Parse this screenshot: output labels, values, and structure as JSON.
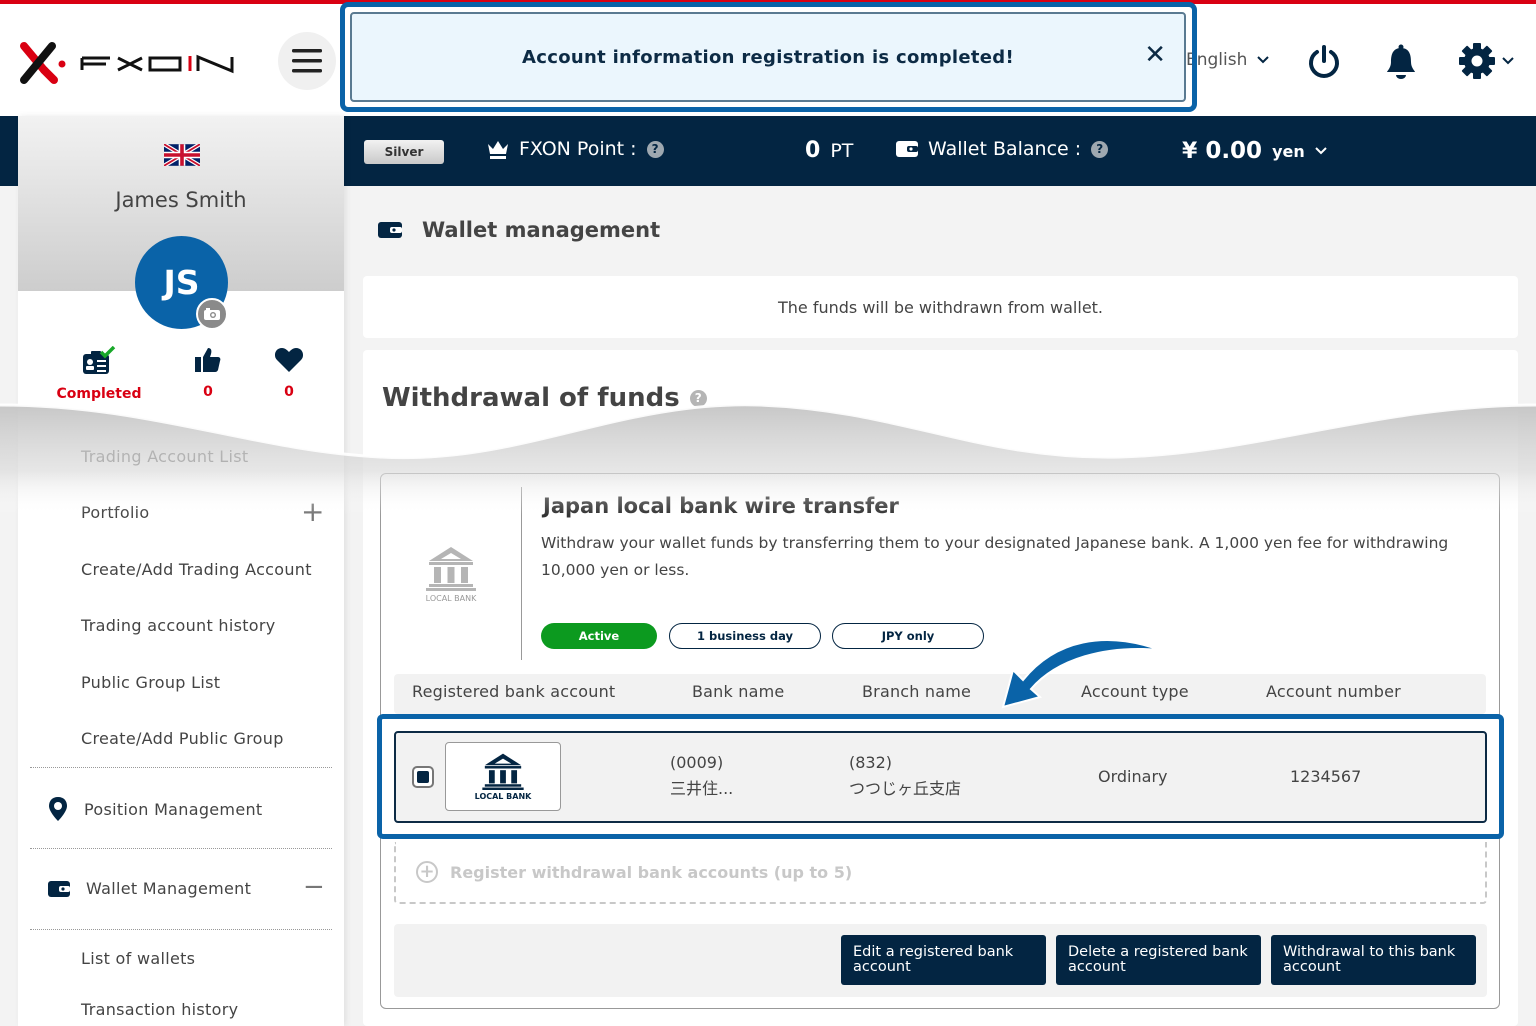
{
  "brand": {
    "name": "FXON",
    "accent_red": "#d90012",
    "navy": "#032542",
    "blue": "#0a63a8"
  },
  "header": {
    "language": "English",
    "icons": [
      "menu-icon",
      "power-icon",
      "bell-icon",
      "gear-icon"
    ]
  },
  "toast": {
    "message": "Account information registration is completed!",
    "close": "✕"
  },
  "status_bar": {
    "tier": "Silver",
    "point_label": "FXON Point :",
    "point_value": "0",
    "point_unit": "PT",
    "wallet_label": "Wallet Balance :",
    "wallet_currency": "¥",
    "wallet_value": "0.00",
    "wallet_unit": "yen",
    "help": "?"
  },
  "profile": {
    "name": "James Smith",
    "initials": "JS",
    "stats": [
      {
        "icon": "id-card-check-icon",
        "label": "Completed"
      },
      {
        "icon": "thumbs-up-icon",
        "label": "0"
      },
      {
        "icon": "heart-icon",
        "label": "0"
      }
    ]
  },
  "sidebar": {
    "items": [
      {
        "label": "Trading Account List"
      },
      {
        "label": "Portfolio",
        "toggle": "+"
      },
      {
        "label": "Create/Add Trading Account"
      },
      {
        "label": "Trading account history"
      },
      {
        "label": "Public Group List"
      },
      {
        "label": "Create/Add Public Group"
      }
    ],
    "position": {
      "label": "Position Management"
    },
    "wallet": {
      "label": "Wallet Management",
      "toggle": "−"
    },
    "wallet_items": [
      {
        "label": "List of wallets"
      },
      {
        "label": "Transaction history"
      }
    ]
  },
  "main": {
    "page_title": "Wallet management",
    "info": "The funds will be withdrawn from wallet.",
    "section_title": "Withdrawal of funds",
    "method": {
      "icon_label": "LOCAL BANK",
      "title": "Japan local bank wire transfer",
      "description": "Withdraw your wallet funds by transferring them to your designated Japanese bank. A 1,000 yen fee for withdrawing 10,000 yen or less.",
      "tags": [
        "Active",
        "1 business day",
        "JPY only"
      ]
    },
    "table": {
      "headers": [
        "Registered bank account",
        "Bank name",
        "Branch name",
        "Account type",
        "Account number"
      ],
      "rows": [
        {
          "logo_label": "LOCAL BANK",
          "bank_code": "(0009)",
          "bank_name": "三井住...",
          "branch_code": "(832)",
          "branch_name": "つつじヶ丘支店",
          "account_type": "Ordinary",
          "account_number": "1234567",
          "selected": true
        }
      ]
    },
    "register_label": "Register withdrawal bank accounts (up to 5)",
    "actions": [
      "Edit a registered bank account",
      "Delete a registered bank account",
      "Withdrawal to this bank account"
    ]
  }
}
